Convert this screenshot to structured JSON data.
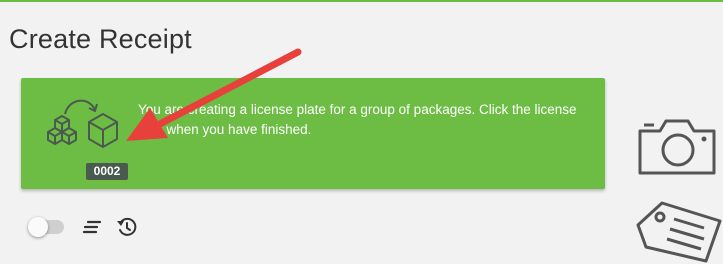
{
  "page": {
    "title": "Create Receipt"
  },
  "banner": {
    "message": "You are creating a license plate for a group of packages. Click the license icon when you have finished.",
    "plate_number": "0002",
    "background_color": "#6dbd45",
    "icon": "boxes-to-box-icon"
  },
  "annotation": {
    "arrow_color": "#e8413b"
  },
  "toolbar": {
    "toggle_state": "off",
    "icons": [
      "lines-icon",
      "history-icon"
    ]
  },
  "side_actions": {
    "icons": [
      "camera-icon",
      "tag-icon"
    ]
  }
}
